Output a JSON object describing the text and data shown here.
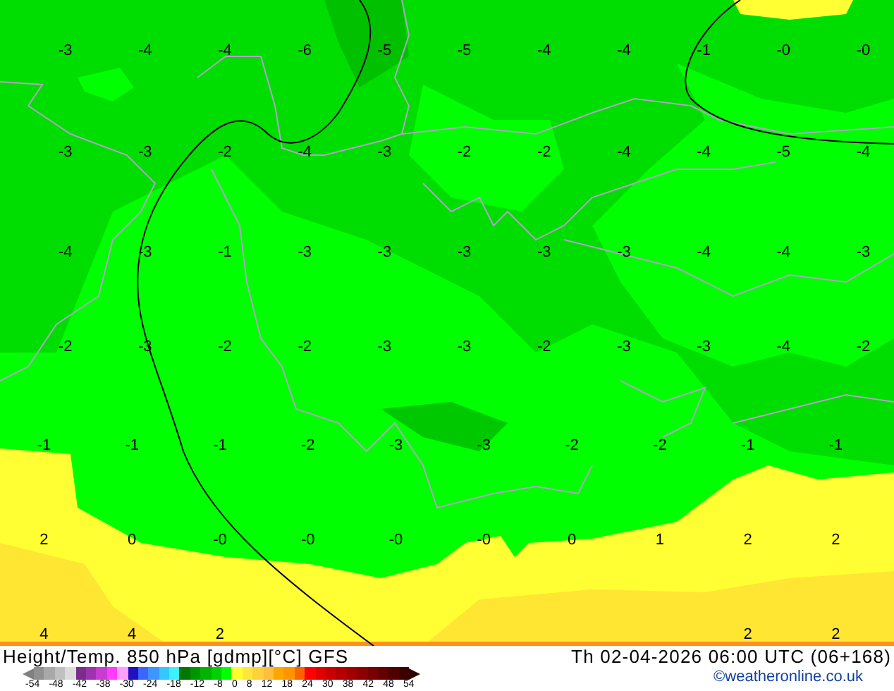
{
  "map": {
    "label_rows": [
      [
        "-3",
        "-4",
        "-4",
        "-6",
        "-5",
        "-5",
        "-4",
        "-4",
        "-1",
        "-0",
        "-0"
      ],
      [
        "-3",
        "-3",
        "-2",
        "-4",
        "-3",
        "-2",
        "-2",
        "-4",
        "-4",
        "-5",
        "-4"
      ],
      [
        "-4",
        "-3",
        "-1",
        "-3",
        "-3",
        "-3",
        "-3",
        "-3",
        "-4",
        "-4",
        "-3"
      ],
      [
        "-2",
        "-3",
        "-2",
        "-2",
        "-3",
        "-3",
        "-2",
        "-3",
        "-3",
        "-4",
        "-2"
      ],
      [
        "-1",
        "-1",
        "-1",
        "-2",
        "-3",
        "-3",
        "-2",
        "-2",
        "-1",
        "-1"
      ],
      [
        "2",
        "0",
        "-0",
        "-0",
        "-0",
        "-0",
        "0",
        "1",
        "2",
        "2"
      ],
      [
        "4",
        "4",
        "2",
        null,
        null,
        null,
        null,
        null,
        "2",
        "2"
      ]
    ]
  },
  "footer": {
    "title": "Height/Temp. 850 hPa [gdmp][°C] GFS",
    "datetime": "Th 02-04-2026 06:00 UTC (06+168)",
    "credit": "©weatheronline.co.uk",
    "legend": {
      "swatches": [
        {
          "color": "#909090"
        },
        {
          "color": "#a8a8a8"
        },
        {
          "color": "#c0c0c0"
        },
        {
          "color": "#dcdcdc"
        },
        {
          "color": "#7a2d8c"
        },
        {
          "color": "#a032b0"
        },
        {
          "color": "#c83cd2"
        },
        {
          "color": "#ff3cff"
        },
        {
          "color": "#ffa0ff"
        },
        {
          "color": "#2010c0"
        },
        {
          "color": "#3c64ff"
        },
        {
          "color": "#3c96ff"
        },
        {
          "color": "#32c8ff"
        },
        {
          "color": "#3cf0ff"
        },
        {
          "color": "#007800"
        },
        {
          "color": "#009600"
        },
        {
          "color": "#00b400"
        },
        {
          "color": "#00d200"
        },
        {
          "color": "#00ff00"
        },
        {
          "color": "#ffff30"
        },
        {
          "color": "#ffe63c"
        },
        {
          "color": "#ffd23c"
        },
        {
          "color": "#ffbe3c"
        },
        {
          "color": "#ffa500"
        },
        {
          "color": "#ff9600"
        },
        {
          "color": "#ff6400"
        },
        {
          "color": "#ff0000"
        },
        {
          "color": "#e00000"
        },
        {
          "color": "#c80000"
        },
        {
          "color": "#b40000"
        },
        {
          "color": "#a00000"
        },
        {
          "color": "#8c0000"
        },
        {
          "color": "#780000"
        },
        {
          "color": "#640000"
        },
        {
          "color": "#500000"
        },
        {
          "color": "#3c0000"
        }
      ],
      "labels": [
        "-54",
        "-48",
        "-42",
        "-38",
        "-30",
        "-24",
        "-18",
        "-12",
        "-8",
        "0",
        "8",
        "12",
        "18",
        "24",
        "30",
        "38",
        "42",
        "48",
        "54"
      ]
    }
  }
}
